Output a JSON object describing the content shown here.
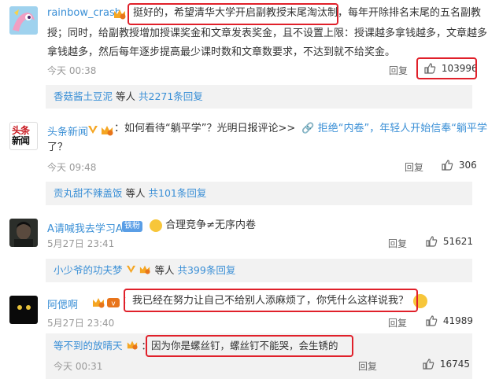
{
  "comments": [
    {
      "username": "rainbow_crash",
      "text_line1": "挺好的，希望清华大学开启副教授末尾淘汰制，每年开除排名末尾的五名副教",
      "text_line1_hl": "挺好的，希望清华大学开启副教授末尾淘汰制，",
      "text_line1_rest": "每年开除排名末尾的五名副教",
      "text_line2": "授；同时，给副教授增加授课奖金和文章发表奖金，且不设置上限：授课越多拿钱越多，文章越多",
      "text_line3": "拿钱越多，然后每年逐步提高最少课时数和文章数要求，不达到就不给奖金。",
      "time": "今天 00:38",
      "reply_label": "回复",
      "likes": "103996",
      "sub_user": "香菇酱土豆泥",
      "sub_mid": "等人",
      "sub_count": "共2271条回复"
    },
    {
      "username": "头条新闻",
      "text_a": "：如何看待“躺平学”？光明日报评论>>",
      "text_link": "拒绝“内卷”，年轻人开始信奉“躺平学”",
      "text_line2": "了？",
      "time": "今天 09:48",
      "reply_label": "回复",
      "likes": "306",
      "sub_user": "贡丸甜不辣盖饭",
      "sub_mid": "等人",
      "sub_count": "共101条回复"
    },
    {
      "username": "A请喊我去学习A",
      "badge": "铁粉",
      "text": "合理竞争≠无序内卷",
      "time": "5月27日 23:41",
      "reply_label": "回复",
      "likes": "51621",
      "sub_user": "小少爷的功夫梦",
      "sub_mid": "等人",
      "sub_count": "共399条回复"
    },
    {
      "username": "阿偲啊",
      "text": "：我已经在努力让自己不给别人添麻烦了，你凭什么这样说我？",
      "time": "5月27日 23:40",
      "reply_label": "回复",
      "likes": "41989",
      "sub_user": "等不到的放晴天",
      "sub_text": "：因为你是螺丝钉，螺丝钉不能哭，会生锈的",
      "sub_time": "今天 00:31",
      "sub_reply_label": "回复",
      "sub_likes": "16745"
    }
  ],
  "avatar2_text": [
    "头条",
    "新闻"
  ],
  "colors": {
    "link": "#3a8fd6",
    "highlight_box": "#e0202a",
    "reply_bg": "#f2f2f2",
    "verified": "#f5a623"
  }
}
